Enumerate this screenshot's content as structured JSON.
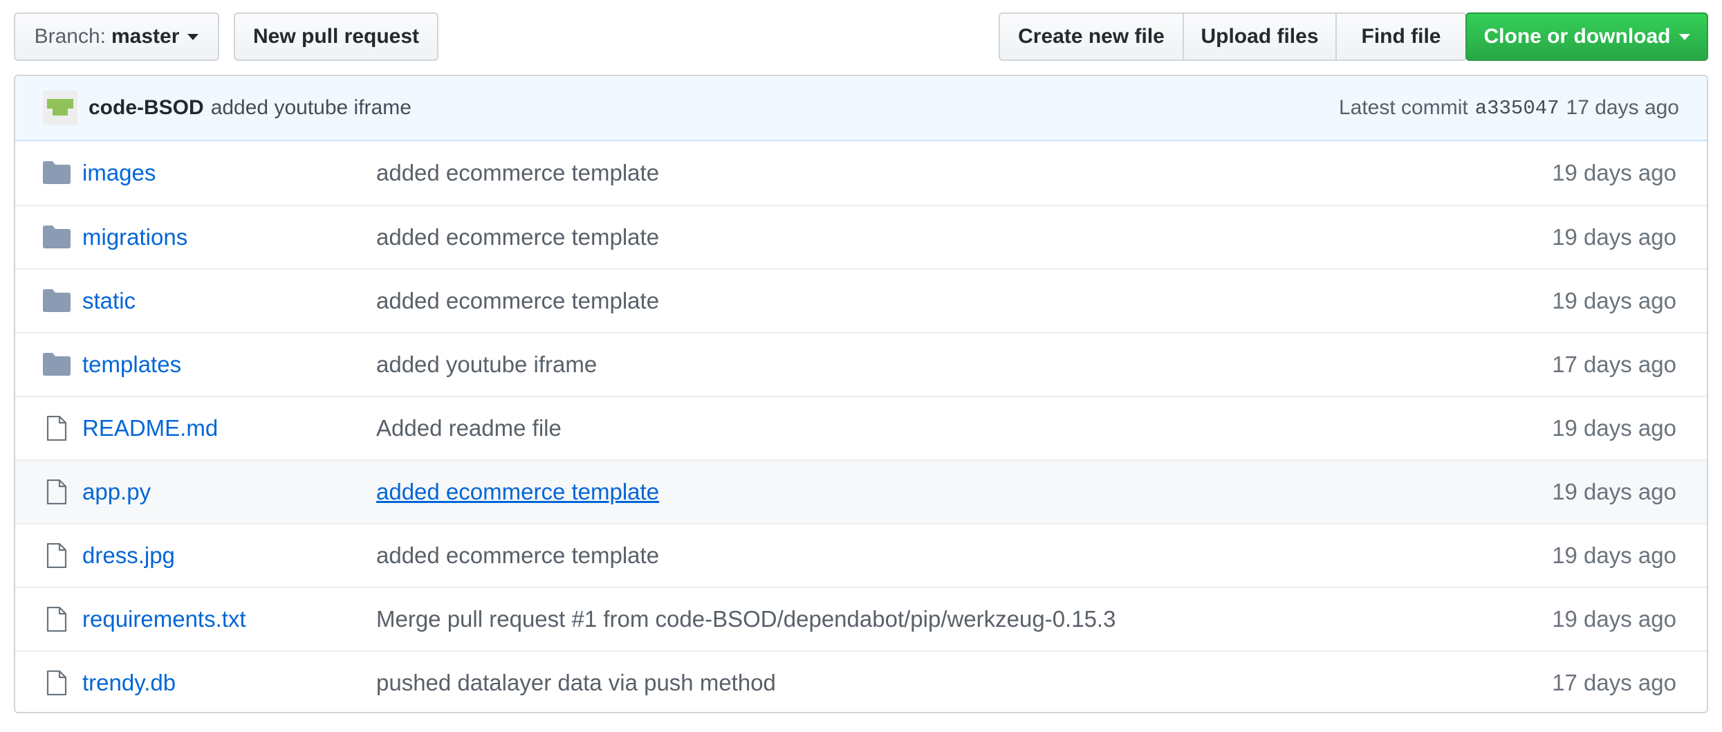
{
  "toolbar": {
    "branch_prefix": "Branch:",
    "branch_name": "master",
    "new_pr_label": "New pull request",
    "create_file_label": "Create new file",
    "upload_label": "Upload files",
    "find_file_label": "Find file",
    "clone_label": "Clone or download"
  },
  "commit": {
    "author": "code-BSOD",
    "message": "added youtube iframe",
    "latest_label": "Latest commit",
    "sha": "a335047",
    "age": "17 days ago"
  },
  "files": [
    {
      "name": "images",
      "type": "folder",
      "message": "added ecommerce template",
      "age": "19 days ago"
    },
    {
      "name": "migrations",
      "type": "folder",
      "message": "added ecommerce template",
      "age": "19 days ago"
    },
    {
      "name": "static",
      "type": "folder",
      "message": "added ecommerce template",
      "age": "19 days ago"
    },
    {
      "name": "templates",
      "type": "folder",
      "message": "added youtube iframe",
      "age": "17 days ago"
    },
    {
      "name": "README.md",
      "type": "file",
      "message": "Added readme file",
      "age": "19 days ago"
    },
    {
      "name": "app.py",
      "type": "file",
      "message": "added ecommerce template",
      "age": "19 days ago"
    },
    {
      "name": "dress.jpg",
      "type": "file",
      "message": "added ecommerce template",
      "age": "19 days ago"
    },
    {
      "name": "requirements.txt",
      "type": "file",
      "message": "Merge pull request #1 from code-BSOD/dependabot/pip/werkzeug-0.15.3",
      "age": "19 days ago"
    },
    {
      "name": "trendy.db",
      "type": "file",
      "message": "pushed datalayer data via push method",
      "age": "17 days ago"
    }
  ],
  "colors": {
    "link": "#0366d6",
    "primary_button": "#28a745",
    "commit_bar_bg": "#f1f8ff",
    "folder_icon": "#79b8ff"
  }
}
